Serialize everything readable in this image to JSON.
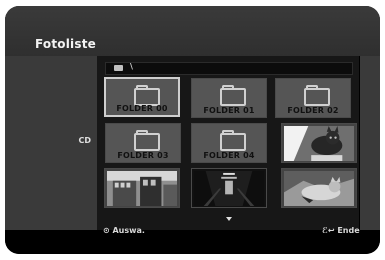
{
  "app": {
    "title": "Fotoliste",
    "source": "CD",
    "path": "\\"
  },
  "grid": {
    "folders": [
      {
        "label": "FOLDER 00",
        "selected": true
      },
      {
        "label": "FOLDER 01",
        "selected": false
      },
      {
        "label": "FOLDER 02",
        "selected": false
      },
      {
        "label": "FOLDER 03",
        "selected": false
      },
      {
        "label": "FOLDER 04",
        "selected": false
      }
    ],
    "photos": [
      {
        "name": "cat-photo"
      },
      {
        "name": "street-photo"
      },
      {
        "name": "corridor-photo"
      },
      {
        "name": "kitten-photo"
      }
    ]
  },
  "footer": {
    "select_label": "⊙ Auswa.",
    "end_label": "ℰ↩ Ende"
  },
  "icons": {
    "path": "disc-icon",
    "folder": "folder-icon",
    "scroll_up": "arrow-up-icon",
    "scroll_down": "arrow-down-icon"
  },
  "colors": {
    "panel_bg": "#000000",
    "header_bg": "#333333",
    "folder_bg": "#555555",
    "selected_border": "#cfcfcf",
    "text": "#d9d9d9"
  }
}
